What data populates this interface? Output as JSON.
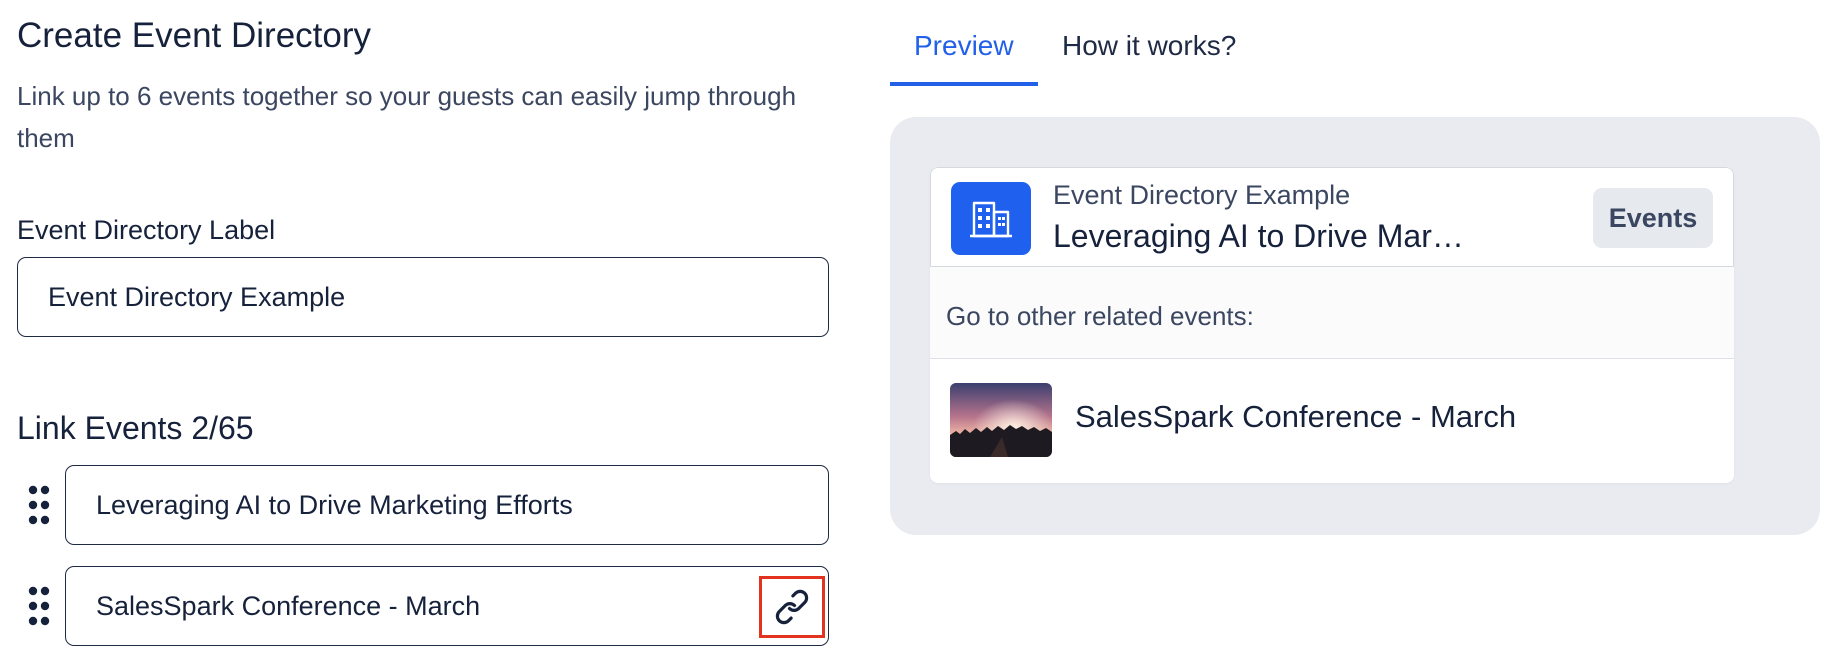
{
  "form": {
    "title": "Create Event Directory",
    "subtitle": "Link up to 6 events together so your guests can easily jump through them",
    "label_field": {
      "label": "Event Directory Label",
      "value": "Event Directory Example"
    },
    "link_events": {
      "heading": "Link Events 2/65",
      "events": [
        {
          "name": "Leveraging AI to Drive Marketing Efforts"
        },
        {
          "name": "SalesSpark Conference - March"
        }
      ],
      "link_icon": "link-icon",
      "highlight_color": "#e2331f"
    }
  },
  "tabs": [
    {
      "label": "Preview",
      "active": true
    },
    {
      "label": "How it works?",
      "active": false
    }
  ],
  "preview": {
    "directory_name": "Event Directory Example",
    "current_event_title": "Leveraging AI to Drive Mar…",
    "events_button": "Events",
    "related_label": "Go to other related events:",
    "related_events": [
      {
        "name": "SalesSpark Conference - March"
      }
    ],
    "logo_icon": "building-icon",
    "logo_color": "#2060ee"
  },
  "colors": {
    "accent": "#2260e8",
    "text": "#16213b",
    "preview_bg": "#e9ebf0"
  }
}
